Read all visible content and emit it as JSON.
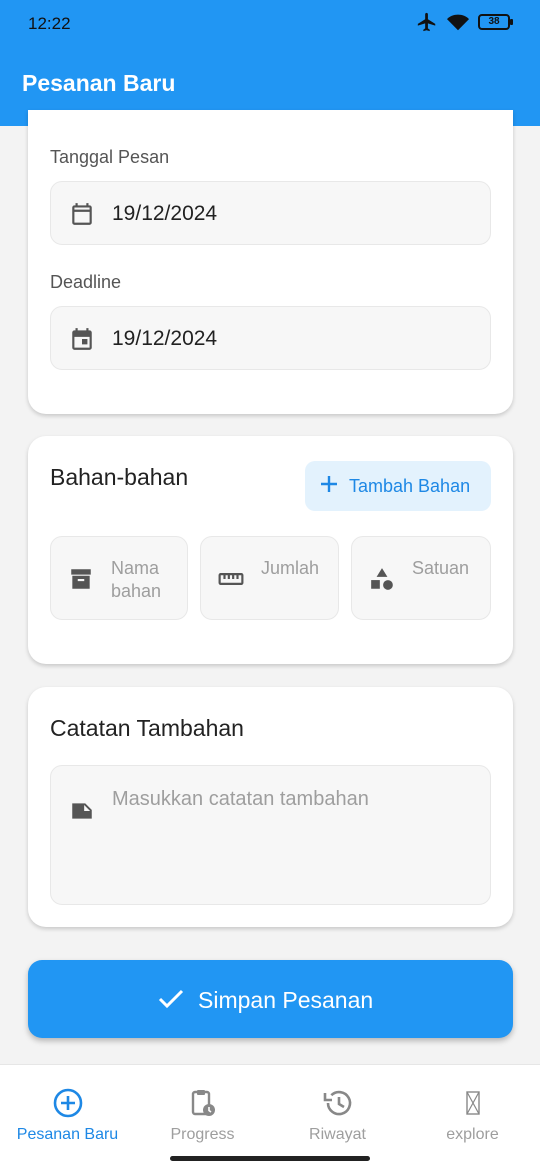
{
  "status": {
    "time": "12:22",
    "battery": "38"
  },
  "appbar": {
    "title": "Pesanan Baru"
  },
  "order": {
    "tanggal_label": "Tanggal Pesan",
    "tanggal_value": "19/12/2024",
    "deadline_label": "Deadline",
    "deadline_value": "19/12/2024"
  },
  "bahan": {
    "title": "Bahan-bahan",
    "add_button": "Tambah Bahan",
    "nama_placeholder": "Nama bahan",
    "jumlah_placeholder": "Jumlah",
    "satuan_placeholder": "Satuan"
  },
  "catatan": {
    "title": "Catatan Tambahan",
    "placeholder": "Masukkan catatan tambahan"
  },
  "save_button": "Simpan Pesanan",
  "nav": [
    {
      "label": "Pesanan Baru",
      "icon": "add-circle-icon",
      "active": true
    },
    {
      "label": "Progress",
      "icon": "clipboard-clock-icon",
      "active": false
    },
    {
      "label": "Riwayat",
      "icon": "history-icon",
      "active": false
    },
    {
      "label": "explore",
      "icon": "missing-glyph-icon",
      "active": false
    }
  ],
  "colors": {
    "primary": "#2196f3",
    "accent": "#1e88e5",
    "add_button_bg": "#e3f2fd"
  }
}
